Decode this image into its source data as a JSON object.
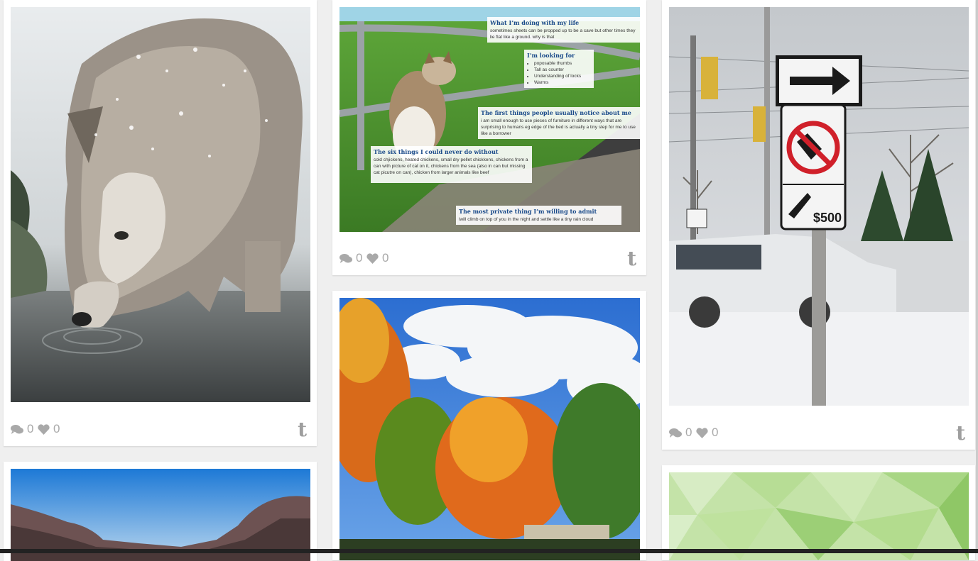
{
  "posts": [
    {
      "name": "wolf",
      "comments": "0",
      "likes": "0"
    },
    {
      "name": "cat",
      "comments": "0",
      "likes": "0"
    },
    {
      "name": "sign",
      "comments": "0",
      "likes": "0"
    }
  ],
  "icons": {
    "comment": "comment-icon",
    "like": "heart-icon",
    "source": "tumblr-icon"
  },
  "tumblr_glyph": "t",
  "cat_profile": {
    "s1_title": "What I’m doing with my life",
    "s1_text": "sometimes sheets can be propped up to be a cave but other times they lie flat like a ground. why is that",
    "s2_title": "I’m looking for",
    "s2_items": [
      "poposable thumbs",
      "Tall as counter",
      "Understanding of locks",
      "Warms"
    ],
    "s3_title": "The first things people usually notice about me",
    "s3_text": "i am small enough to use pieces of furniture in different ways that are surprising to humans eg edge of the bed is actually a tiny step for me to use like a borrower",
    "s4_title": "The six things I could never do without",
    "s4_text": "cold chjickens, heated chickens, small dry pellet chickkens, chickens from a can with picture of cat on it, chickens from the sea (also in can but missing cat picutre on can), chicken from larger animals like beef",
    "s5_title": "The most private thing I’m willing to admit",
    "s5_text": "iwill climb on top of you in the night and settle like a tiny rain cloud"
  },
  "sign_price": "$500",
  "colors": {
    "background": "#efefef",
    "card": "#ffffff",
    "meta": "#a9a9a9",
    "profile_heading": "#1a4a8a"
  }
}
